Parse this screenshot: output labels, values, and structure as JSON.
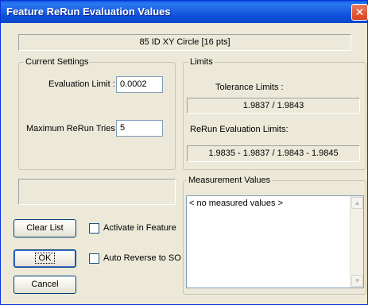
{
  "window": {
    "title": "Feature ReRun Evaluation Values",
    "close_glyph": "✕"
  },
  "feature_name": "85 ID XY Circle [16 pts]",
  "current_settings": {
    "legend": "Current Settings",
    "evaluation_limit_label": "Evaluation Limit :",
    "evaluation_limit_value": "0.0002",
    "max_rerun_label": "Maximum ReRun Tries :",
    "max_rerun_value": "5"
  },
  "limits": {
    "legend": "Limits",
    "tolerance_label": "Tolerance Limits :",
    "tolerance_value": "1.9837 / 1.9843",
    "rerun_label": "ReRun Evaluation Limits:",
    "rerun_value": "1.9835 - 1.9837 / 1.9843 - 1.9845"
  },
  "measurement": {
    "legend": "Measurement Values",
    "items": [
      "< no measured values >"
    ]
  },
  "buttons": {
    "clear_list": "Clear List",
    "ok": "OK",
    "cancel": "Cancel"
  },
  "checkboxes": {
    "activate_in_feature": {
      "label": "Activate in Feature",
      "checked": false
    },
    "auto_reverse": {
      "label": "Auto Reverse to SO",
      "checked": false
    }
  },
  "icons": {
    "scroll_up": "▲",
    "scroll_down": "▼"
  }
}
